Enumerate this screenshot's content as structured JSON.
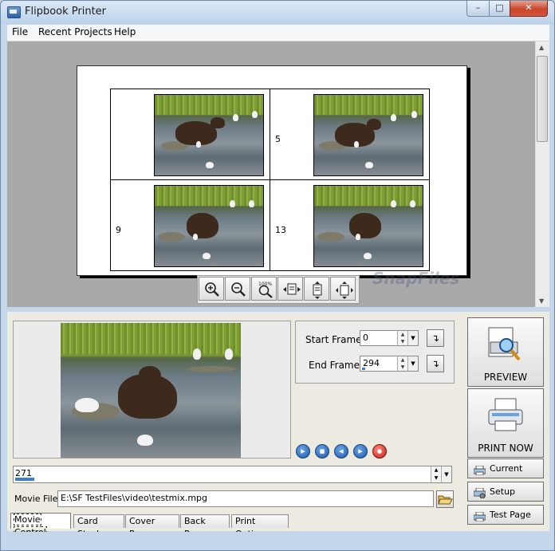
{
  "window": {
    "title": "Flipbook Printer"
  },
  "menu": {
    "items": [
      "File",
      "Recent Projects",
      "Help"
    ]
  },
  "preview": {
    "cells": [
      {
        "number": ""
      },
      {
        "number": "5"
      },
      {
        "number": "9"
      },
      {
        "number": "13"
      }
    ]
  },
  "watermark": "SnapFiles",
  "frames": {
    "start_label": "Start Frame #",
    "start_value": "0",
    "end_label": "End Frame #",
    "end_value": "294"
  },
  "position": {
    "value": "271"
  },
  "movie": {
    "label": "Movie File:",
    "path": "E:\\SF TestFiles\\video\\testmix.mpg"
  },
  "tabs": [
    "Movie Control",
    "Card Stock",
    "Cover Page",
    "Back Page",
    "Print Options"
  ],
  "actions": {
    "preview": "PREVIEW",
    "print_now": "PRINT NOW",
    "current_page": "Current Page",
    "setup_printers": "Setup Printers",
    "test_page": "Test Page"
  },
  "icons": {
    "zoom": [
      "zoom-in-icon",
      "zoom-out-icon",
      "zoom-100-icon",
      "fit-width-icon",
      "fit-height-icon",
      "fit-page-icon"
    ],
    "playback": [
      "play-icon",
      "stop-icon",
      "previous-icon",
      "next-icon",
      "record-icon"
    ]
  },
  "zoom_100_text": "100%",
  "colors": {
    "titlebar": "#c4d6ea",
    "close": "#c9452b",
    "accent": "#3a7bd5"
  }
}
